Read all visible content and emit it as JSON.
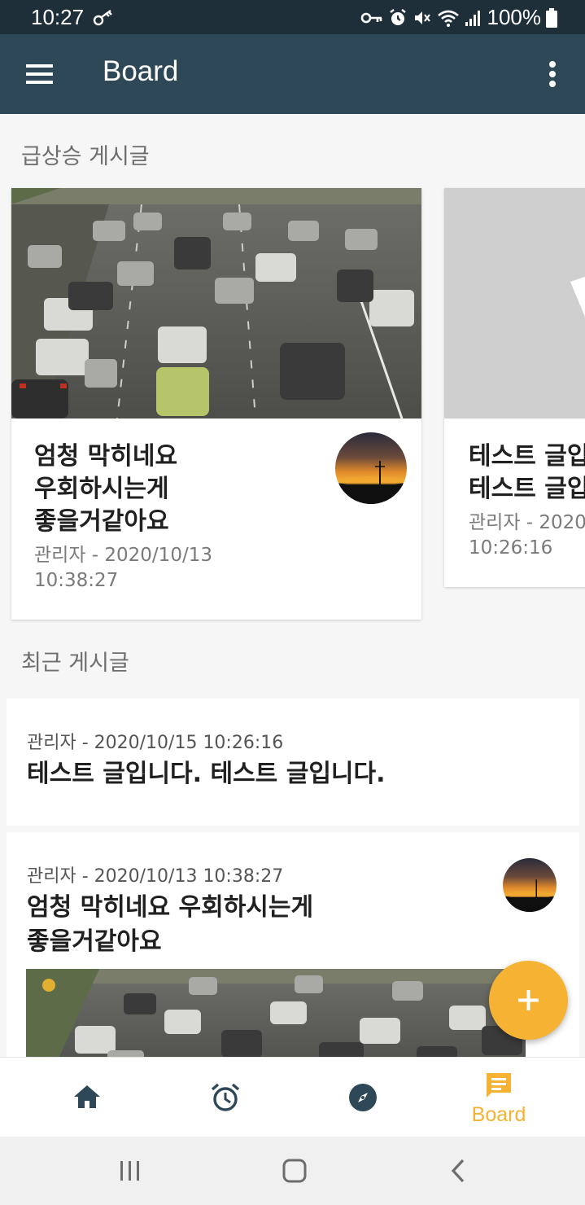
{
  "status_bar": {
    "time": "10:27",
    "battery": "100%"
  },
  "app_bar": {
    "title": "Board",
    "menu_icon": "hamburger-menu-icon",
    "more_icon": "more-vertical-icon"
  },
  "sections": {
    "trending": "급상승 게시글",
    "recent": "최근 게시글"
  },
  "trending_posts": [
    {
      "title": "엄청 막히네요\n우회하시는게\n좋을거같아요",
      "meta": "관리자 - 2020/10/13\n10:38:27",
      "image": "traffic-photo",
      "avatar": "sunset-avatar"
    },
    {
      "title": "테스트 글입\n테스트 글입",
      "meta": "관리자 - 2020\n10:26:16",
      "image": "placeholder-image"
    }
  ],
  "recent_posts": [
    {
      "meta": "관리자 - 2020/10/15 10:26:16",
      "title": "테스트 글입니다. 테스트 글입니다."
    },
    {
      "meta": "관리자 - 2020/10/13 10:38:27",
      "title": "엄청 막히네요 우회하시는게\n좋을거같아요",
      "avatar": "sunset-avatar",
      "image": "traffic-photo"
    }
  ],
  "fab": {
    "icon": "plus-icon"
  },
  "bottom_nav": [
    {
      "icon": "home-icon"
    },
    {
      "icon": "alarm-icon"
    },
    {
      "icon": "compass-icon"
    },
    {
      "icon": "board-chat-icon",
      "label": "Board",
      "active": true
    }
  ],
  "colors": {
    "status_bar": "#1f2f3a",
    "app_bar": "#2f4858",
    "accent": "#f5b233",
    "nav_icon": "#2f4858",
    "background": "#f6f6f6"
  }
}
